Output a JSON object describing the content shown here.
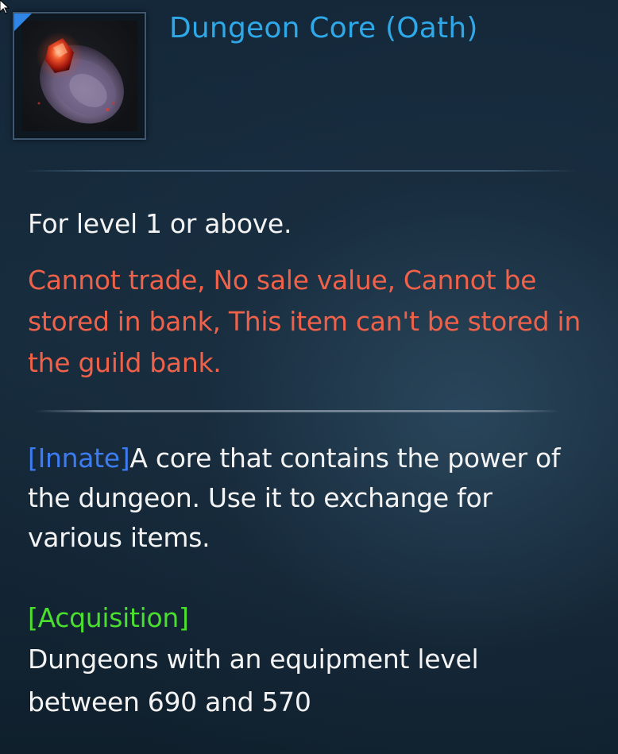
{
  "item": {
    "name": "Dungeon Core (Oath)",
    "icon": "dungeon-core-icon",
    "grade_color": "#2f86e6"
  },
  "requirements": {
    "level_text": "For level 1 or above."
  },
  "restrictions": {
    "text": "Cannot trade, No sale value, Cannot be stored in bank, This item can't be stored in the guild bank."
  },
  "description": {
    "tag": "[Innate]",
    "text": "A core that contains the power of the dungeon. Use it to exchange for various items."
  },
  "acquisition": {
    "label": "[Acquisition]",
    "text": "Dungeons with an equipment level between 690 and 570"
  },
  "colors": {
    "title": "#2fa8e8",
    "restriction": "#f0614a",
    "innate_tag": "#3d7cf0",
    "acquisition_tag": "#4ade2e",
    "body_text": "#f3f3f3"
  }
}
